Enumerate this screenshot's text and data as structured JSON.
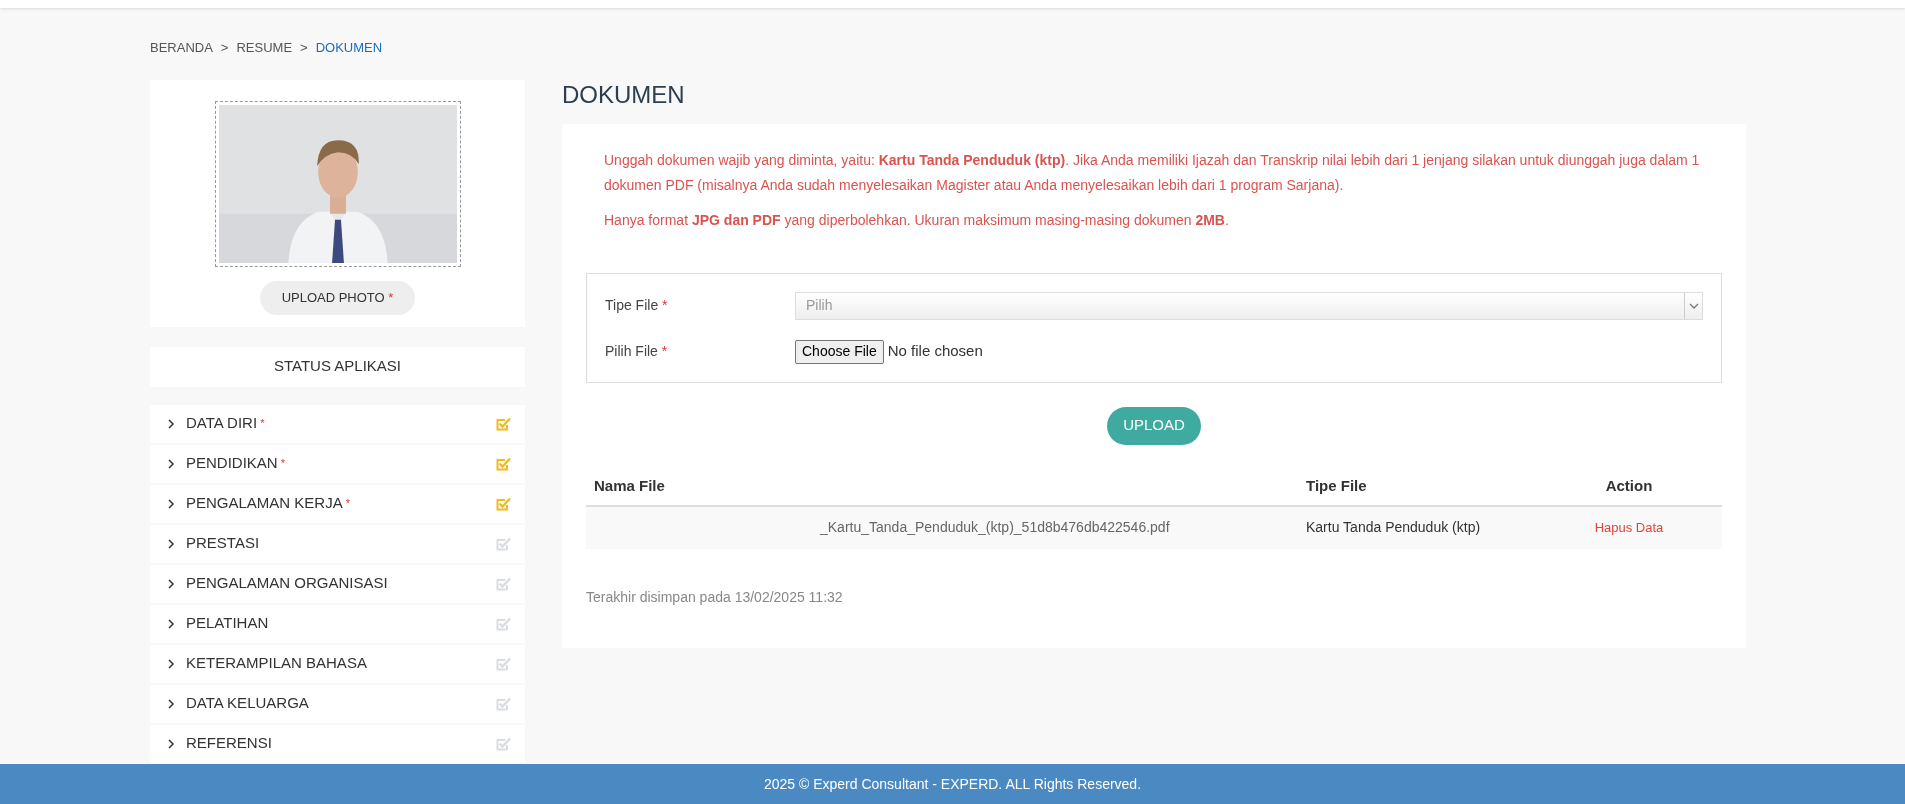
{
  "breadcrumb": [
    {
      "label": "BERANDA",
      "selected": false
    },
    {
      "label": "RESUME",
      "selected": false
    },
    {
      "label": "DOKUMEN",
      "selected": true
    }
  ],
  "breadcrumb_separator": ">",
  "profile": {
    "upload_button": "UPLOAD PHOTO",
    "required_mark": "*"
  },
  "status": {
    "title": "STATUS APLIKASI",
    "items": [
      {
        "label": "DATA DIRI",
        "required": true,
        "checked": true
      },
      {
        "label": "PENDIDIKAN",
        "required": true,
        "checked": true
      },
      {
        "label": "PENGALAMAN KERJA",
        "required": true,
        "checked": true
      },
      {
        "label": "PRESTASI",
        "required": false,
        "checked": false
      },
      {
        "label": "PENGALAMAN ORGANISASI",
        "required": false,
        "checked": false
      },
      {
        "label": "PELATIHAN",
        "required": false,
        "checked": false
      },
      {
        "label": "KETERAMPILAN BAHASA",
        "required": false,
        "checked": false
      },
      {
        "label": "DATA KELUARGA",
        "required": false,
        "checked": false
      },
      {
        "label": "REFERENSI",
        "required": false,
        "checked": false
      }
    ]
  },
  "page_title": "DOKUMEN",
  "notes": [
    "Unggah dokumen wajib yang diminta, yaitu: **Kartu Tanda Penduduk (ktp)**. Jika Anda memiliki Ijazah dan Transkrip nilai lebih dari 1 jenjang silakan untuk diunggah juga dalam 1 dokumen PDF (misalnya Anda sudah menyelesaikan Magister atau Anda menyelesaikan lebih dari 1 program Sarjana).",
    "Hanya format **JPG dan PDF** yang diperbolehkan. Ukuran maksimum masing-masing dokumen **2MB**."
  ],
  "form": {
    "fields": [
      {
        "kind": "select",
        "label": "Tipe File",
        "required_mark": "*",
        "placeholder": "Pilih"
      },
      {
        "kind": "file",
        "label": "Pilih File",
        "required_mark": "*",
        "button": "Choose File",
        "value": "No file chosen"
      }
    ],
    "submit": "UPLOAD"
  },
  "table": {
    "columns": [
      "Nama File",
      "Tipe File",
      "Action"
    ],
    "rows": [
      {
        "file_name": "_Kartu_Tanda_Penduduk_(ktp)_51d8b476db422546.pdf",
        "file_type": "Kartu Tanda Penduduk (ktp)",
        "action": "Hapus Data"
      }
    ]
  },
  "last_saved": "Terakhir disimpan pada 13/02/2025 11:32",
  "footer": "2025 © Experd Consultant - EXPERD. ALL Rights Reserved."
}
